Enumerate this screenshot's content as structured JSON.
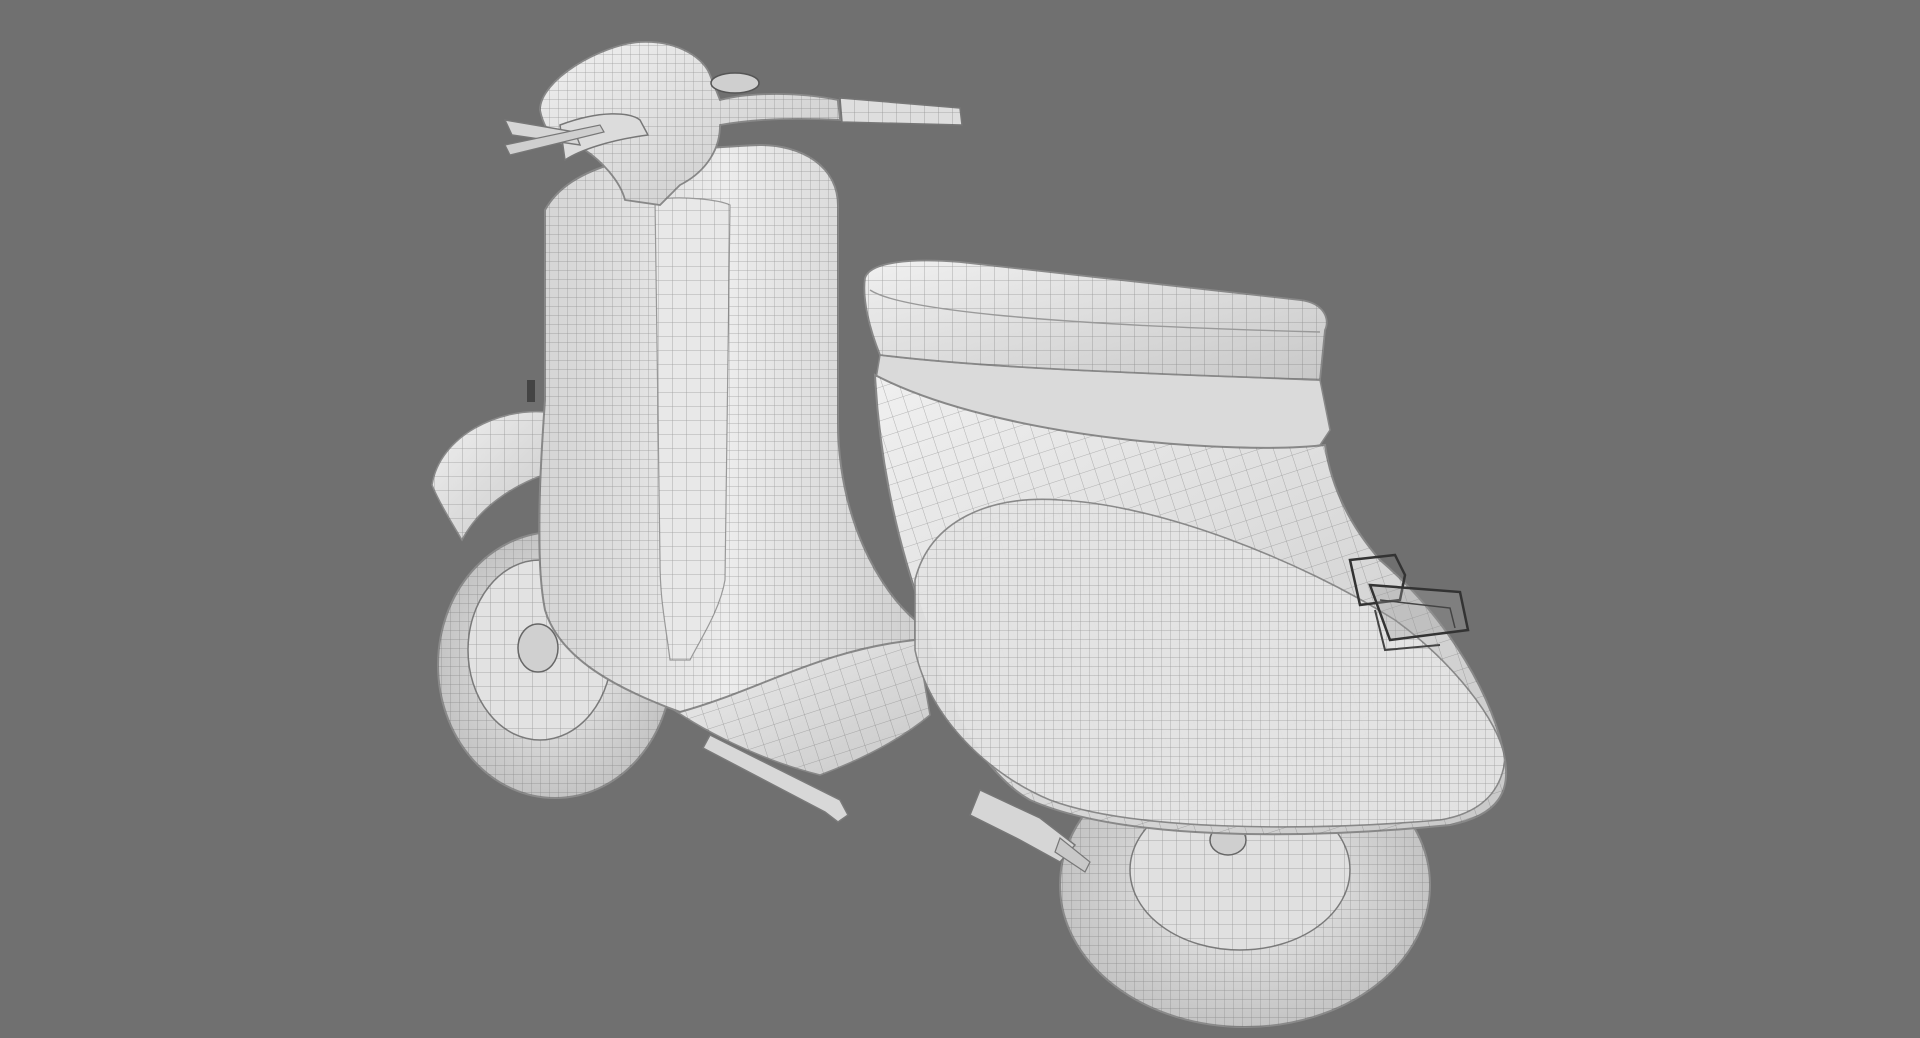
{
  "scene": {
    "subject": "scooter-wireframe-render",
    "colors": {
      "background": "#707070",
      "body": "#e6e6e6",
      "body_shade": "#c9c9c9",
      "body_dark": "#a8a8a8",
      "wire": "#5a5a5a",
      "tire": "#dcdcdc",
      "glass": "#8a8a8a"
    }
  }
}
